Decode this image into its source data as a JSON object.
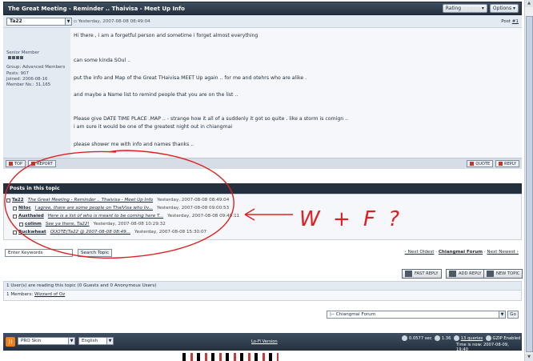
{
  "thread": {
    "title": "The Great Meeting - Reminder .. Thaivisa - Meet Up Info",
    "rating_label": "Rating",
    "stars": "☆☆☆☆☆",
    "options_label": "Options"
  },
  "post": {
    "username": "Ta22",
    "date": "Yesterday, 2007-08-08 08:49:04",
    "post_label": "Post",
    "post_number": "#1",
    "author": {
      "rank": "Senior Member",
      "group": "Group: Advanced Members",
      "posts": "Posts: 907",
      "joined": "Joined: 2006-08-16",
      "member_no": "Member No.: 31,165"
    },
    "lines": [
      "Hi there , i am a forgetful person and sometime i forget almost everything",
      "can some kinda SOul ..",
      "put the info and Map of the Great THaivisa MEET Up again .. for me and otehrs who are alike .",
      "and maybe a Name list to remind people that you are on the list ..",
      "Please give DATE TIME PLACE .MAP .. - strange how it all of a suddenly it got so quite . like a storm is comign ..",
      "i am sure it would be one of the greatest night out in chiangmai",
      "please shower me with info and names thanks .."
    ],
    "buttons": {
      "top": "TOP",
      "report": "REPORT",
      "quote": "QUOTE",
      "reply": "REPLY"
    }
  },
  "posts_in_topic": {
    "heading": "Posts in this topic",
    "rows": [
      {
        "who": "Ta22",
        "snippet": "The Great Meeting - Reminder .. Thaivisa - Meet Up Info",
        "when": "Yesterday, 2007-08-08 08:49:04"
      },
      {
        "who": "Niloc",
        "snippet": "I agree, there are some people on ThaiVisa who liv...",
        "when": "Yesterday, 2007-08-08 09:00:53"
      },
      {
        "who": "Austhaied",
        "snippet": "Here is a list of who is meant to be coming here T...",
        "when": "Yesterday, 2007-08-08 09:49:11"
      },
      {
        "who": "colinm",
        "snippet": "See ya there, Ta22!",
        "when": "Yesterday, 2007-08-08 10:29:32"
      },
      {
        "who": "Buckwheat",
        "snippet": "QUOTE(Ta22 @ 2007-08-08 08:49...",
        "when": "Yesterday, 2007-08-08 15:30:07"
      }
    ]
  },
  "search": {
    "placeholder": "Enter Keywords",
    "button": "Search Topic"
  },
  "topic_nav": {
    "prev": "‹ Next Oldest",
    "sep1": "·",
    "forum": "Chiangmai Forum",
    "sep2": "·",
    "next": "Next Newest ›"
  },
  "reply_buttons": {
    "fast": "FAST REPLY",
    "add": "ADD REPLY",
    "new": "NEW TOPIC"
  },
  "readers": {
    "heading": "1 User(s) are reading this topic (0 Guests and 0 Anonymous Users)",
    "members_label": "1 Members:",
    "member": "Wizzard of Oz"
  },
  "jump": {
    "selected": "|-- Chiangmai Forum",
    "go": "Go"
  },
  "footer": {
    "rss": "))",
    "skin": "PRO Skin",
    "language": "English",
    "lofi": "Lo-Fi Version",
    "exec": "0.0577 sec",
    "load": "1.36",
    "queries": "13 queries",
    "queries_link": "queries",
    "gzip": "GZIP Enabled",
    "time_now": "Time is now: 2007-08-09, 19:40"
  },
  "annotation": {
    "text": "W + F ?",
    "color": "#e02020"
  }
}
